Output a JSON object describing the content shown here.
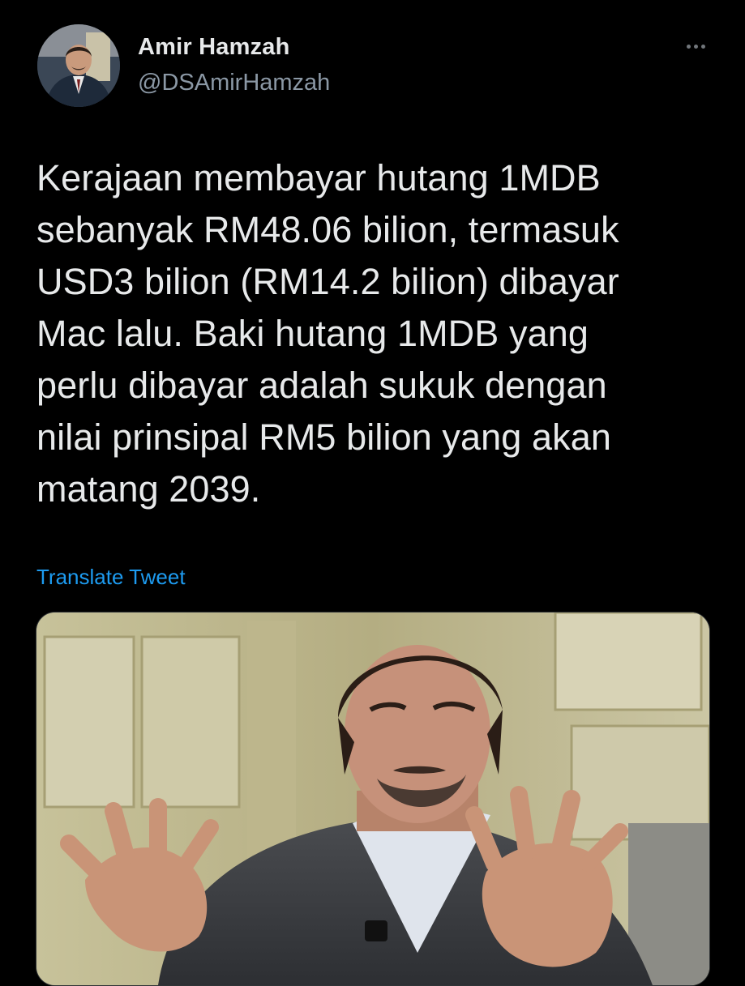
{
  "tweet": {
    "author": {
      "name": "Amir Hamzah",
      "handle": "@DSAmirHamzah",
      "avatar_icon": "profile-photo"
    },
    "more_icon": "more-horizontal-icon",
    "text": "Kerajaan membayar hutang 1MDB\nsebanyak RM48.06 bilion, termasuk\nUSD3 bilion (RM14.2 bilion) dibayar\nMac lalu. Baki hutang 1MDB yang\nperlu dibayar adalah sukuk dengan\nnilai prinsipal RM5 bilion yang akan\nmatang 2039.",
    "translate_label": "Translate Tweet",
    "media": {
      "type": "photo"
    }
  },
  "colors": {
    "background": "#000000",
    "text_primary": "#e7e9ea",
    "text_secondary": "#8b98a5",
    "link": "#1d9bf0"
  }
}
